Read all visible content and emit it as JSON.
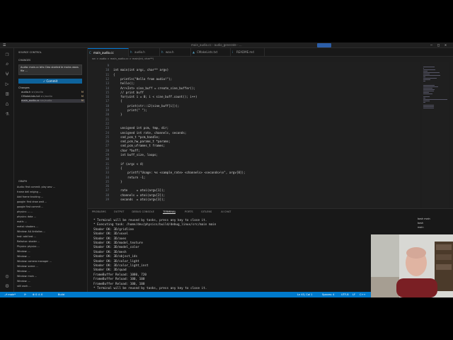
{
  "window": {
    "title": "main_audio.cc - audio_generate - ...",
    "search_label": "Search"
  },
  "activity_bar": [
    "files-icon",
    "search-icon",
    "source-control-icon",
    "run-icon",
    "extensions-icon",
    "remote-icon",
    "test-icon",
    "accounts-icon",
    "settings-icon"
  ],
  "sidebar": {
    "header": "SOURCE CONTROL",
    "section": "CHANGES",
    "message": "Audio: main.cc bits Cleo started  le mains wavs file ...",
    "commit_label": "✓ Commit",
    "changes_label": "Changes",
    "changes": [
      {
        "name": "audio.h",
        "path": "src/audio",
        "status": "M"
      },
      {
        "name": "CMakeLists.txt",
        "path": "src/audio",
        "status": "M"
      },
      {
        "name": "main_audio.cc",
        "path": "src/audio",
        "status": "M"
      }
    ],
    "graph_header": "GRAPH",
    "graph": [
      "Audio: first commit. play wav ...",
      "frame dell edging  ...",
      "Add frame tracking ...",
      "google: first draw wait ...",
      "google first commit ...",
      "physics: ... ...",
      "physics: data ...",
      "math: ...",
      "metal: shaders ...",
      "Window: AA Antialias ...",
      "test: add test ...",
      "Refactor: shader ...",
      "Physics: physics ...",
      "Window: ...",
      "Window: ...",
      "Window: camera manager ...",
      "Window: scene ...",
      "Window: ...",
      "Window: main ...",
      "Window: ...",
      "still work ..."
    ]
  },
  "tabs": [
    {
      "label": "main_audio.cc",
      "active": true
    },
    {
      "label": "audio.h",
      "active": false
    },
    {
      "label": "wav.h",
      "active": false
    },
    {
      "label": "CMakeLists.txt",
      "active": false
    },
    {
      "label": "README.md",
      "active": false
    }
  ],
  "breadcrumb": "src > audio > main_audio.cc > main(int, char**)",
  "editor": {
    "line_numbers": [
      "9",
      "10",
      "11",
      "12",
      "13",
      "14",
      "15",
      "16",
      "17",
      "18",
      "19",
      "20",
      "21",
      "22",
      "23",
      "24",
      "25",
      "26",
      "27",
      "28",
      "29",
      "30",
      "31",
      "32",
      "33",
      "34",
      "35",
      "36",
      "37",
      "38",
      "39",
      "40",
      "41",
      "42",
      "43"
    ],
    "lines": [
      "",
      "int main(int argc, char** argv)",
      "{",
      "    println(\"Hello from audio!\");",
      "    hello();",
      "    Arr<Int> sine_buff = create_sine_buffer();",
      "    // print buff",
      "    for(uint i = 0; i < sine_buff.count(); i++)",
      "    {",
      "        print(str::i2(sine_buff[i]));",
      "        print(\" \");",
      "    }",
      "",
      "",
      "    unsigned int pcm, tmp, dir;",
      "    unsigned int rate, channels, seconds;",
      "    snd_pcm_t *pcm_handle;",
      "    snd_pcm_hw_params_t *params;",
      "    snd_pcm_uframes_t frames;",
      "    char *buff;",
      "    int buff_size, loops;",
      "",
      "    if (argc < 4)",
      "    {",
      "        printf(\"Usage: %s <sample_rate> <channels> <seconds>\\n\", argv[0]);",
      "        return -1;",
      "    }",
      "",
      "    rate     = atoi(argv[1]);",
      "    channels = atoi(argv[2]);",
      "    seconds  = atoi(argv[3]);"
    ]
  },
  "panel": {
    "tabs": [
      "PROBLEMS",
      "OUTPUT",
      "DEBUG CONSOLE",
      "TERMINAL",
      "PORTS",
      "GITLENS",
      "AI CHAT"
    ],
    "active_tab": "TERMINAL",
    "terminal_lines": [
      "* Terminal will be reused by tasks, press any key to close it.",
      "",
      "* Executing task: /home/dev/physics/build/debug_linux/src/main main",
      "",
      "Shader OK: 3D/gridline",
      "Shader OK: 3D/voxel",
      "Shader OK: 3D/axes",
      "Shader OK: 3D/model_texture",
      "Shader OK: 3D/model_color",
      "Shader OK: 3D/mesh",
      "Shader OK: 3D/object_ids",
      "Shader OK: 3D/color_light",
      "Shader OK: 3D/color_light_inst",
      "Shader OK: 3D/quad",
      "FrameBuffer Reload: 1080, 720",
      "FrameBuffer Reload: 100, 100",
      "FrameBuffer Reload: 100, 100",
      "* Terminal will be reused by tasks, press any key to close it."
    ],
    "terminal_list": [
      "bash main",
      "bash",
      "main"
    ]
  },
  "status_bar": {
    "left": [
      "⎇ main*",
      "⟳",
      "⊗ 0 ⚠ 0",
      "Build"
    ],
    "right": [
      "Ln 43, Col 1",
      "Spaces: 4",
      "UTF-8",
      "LF",
      "C++",
      "Linux"
    ]
  }
}
